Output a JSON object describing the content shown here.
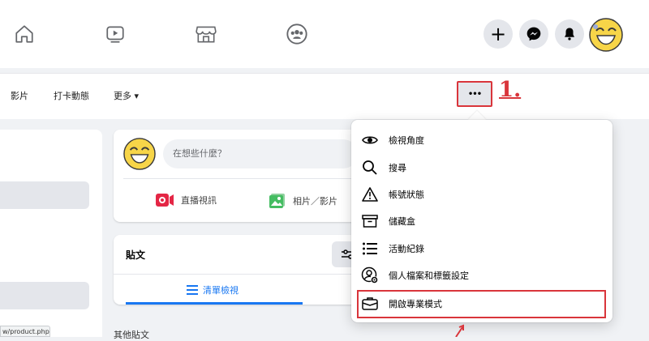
{
  "nav": {
    "icons": [
      "home-icon",
      "watch-icon",
      "marketplace-icon",
      "groups-icon"
    ],
    "right_buttons": [
      "plus-icon",
      "messenger-icon",
      "bell-icon",
      "avatar"
    ]
  },
  "profile_tabs": {
    "items": [
      {
        "label": "影片"
      },
      {
        "label": "打卡動態"
      },
      {
        "label": "更多 ▾"
      }
    ],
    "more_dots": "•••",
    "step_label": "1."
  },
  "composer": {
    "placeholder": "在想些什麼？",
    "actions": [
      {
        "label": "直播視訊",
        "icon": "live-video-icon",
        "color": "#e42645"
      },
      {
        "label": "相片／影片",
        "icon": "photo-icon",
        "color": "#45bd62"
      }
    ]
  },
  "posts": {
    "title": "貼文",
    "list_view": "清單檢視",
    "other": "其他貼文"
  },
  "status_url": "w/product.php",
  "menu": {
    "items": [
      {
        "label": "檢視角度",
        "icon": "eye-icon"
      },
      {
        "label": "搜尋",
        "icon": "search-icon"
      },
      {
        "label": "帳號狀態",
        "icon": "warning-icon"
      },
      {
        "label": "儲藏盒",
        "icon": "archive-icon"
      },
      {
        "label": "活動紀錄",
        "icon": "activity-list-icon"
      },
      {
        "label": "個人檔案和標籤設定",
        "icon": "profile-settings-icon"
      },
      {
        "label": "開啟專業模式",
        "icon": "briefcase-icon"
      }
    ]
  },
  "colors": {
    "accent": "#1877f2",
    "annotation": "#d9353b"
  }
}
